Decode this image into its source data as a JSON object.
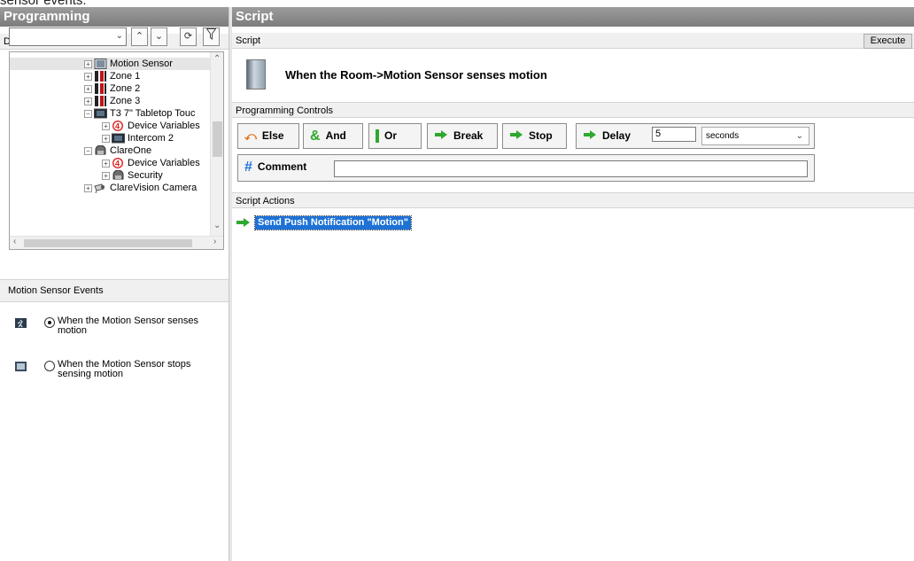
{
  "cropped_top_text": "sensor events.",
  "left_panel": {
    "title": "Programming",
    "device_events_label": "Device Events",
    "tree": [
      {
        "label": "Motion Sensor",
        "icon": "motion-sensor-icon"
      },
      {
        "label": "Zone 1",
        "icon": "zone-icon"
      },
      {
        "label": "Zone 2",
        "icon": "zone-icon"
      },
      {
        "label": "Zone 3",
        "icon": "zone-icon"
      },
      {
        "label": "T3 7\" Tabletop Touc",
        "icon": "touchpanel-icon"
      },
      {
        "label": "Device Variables",
        "icon": "variables-icon"
      },
      {
        "label": "Intercom 2",
        "icon": "intercom-icon"
      },
      {
        "label": "ClareOne",
        "icon": "clareone-icon"
      },
      {
        "label": "Device Variables",
        "icon": "variables-icon"
      },
      {
        "label": "Security",
        "icon": "security-icon"
      },
      {
        "label": "ClareVision Camera",
        "icon": "camera-icon"
      }
    ],
    "events_header": "Motion Sensor Events",
    "events": [
      {
        "label": "When the Motion Sensor senses motion",
        "selected": true
      },
      {
        "label": "When the Motion Sensor stops sensing motion",
        "selected": false
      }
    ]
  },
  "right_panel": {
    "title": "Script",
    "script_label": "Script",
    "execute_label": "Execute",
    "script_title": "When the Room->Motion Sensor senses motion",
    "controls_header": "Programming Controls",
    "controls": {
      "else": "Else",
      "and": "And",
      "or": "Or",
      "break": "Break",
      "stop": "Stop",
      "delay": "Delay",
      "delay_value": "5",
      "delay_unit": "seconds",
      "comment": "Comment"
    },
    "actions_header": "Script Actions",
    "actions": [
      {
        "label": "Send Push Notification \"Motion\""
      }
    ]
  },
  "colors": {
    "header_bg": "#8a8a8a",
    "selection_blue": "#1e72d6",
    "arrow_green": "#2ea82e"
  }
}
